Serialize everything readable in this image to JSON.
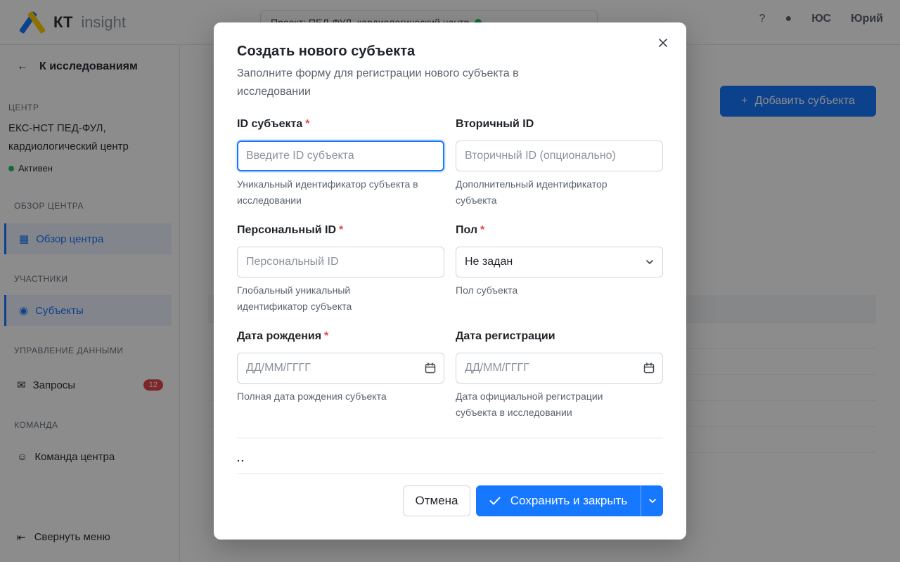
{
  "background": {
    "logo": {
      "mark": "kt-logo-icon",
      "kt": "КТ",
      "insight": "insight"
    },
    "project": {
      "label": "Проект: ПЕД-ФУЛ, кардиологический центр"
    },
    "user": {
      "initials": "ЮС",
      "name": "Юрий"
    },
    "sidebar": {
      "back": "К исследованиям",
      "center_label": "ЦЕНТР",
      "center_name": "ЕКС-НСТ ПЕД-ФУЛ, кардиологический центр",
      "center_status": "Активен",
      "group_center": "ОБЗОР ЦЕНТРА",
      "item_overview": "Обзор центра",
      "group_participants": "УЧАСТНИКИ",
      "item_subjects": "Субъекты",
      "group_data": "УПРАВЛЕНИЕ ДАННЫМИ",
      "item_queries": "Запросы",
      "queries_count": "12",
      "group_team": "КОМАНДА",
      "item_team": "Команда центра",
      "collapse": "Свернуть меню"
    },
    "main": {
      "add_button": "Добавить субъекта"
    }
  },
  "modal": {
    "title": "Создать нового субъекта",
    "subtitle": "Заполните форму для регистрации нового субъекта в исследовании",
    "fields": {
      "subject_id": {
        "label": "ID субъекта",
        "required": "*",
        "placeholder": "Введите ID субъекта",
        "value": "",
        "helper": "Уникальный идентификатор субъекта в исследовании"
      },
      "secondary_id": {
        "label": "Вторичный ID",
        "placeholder": "Вторичный ID (опционально)",
        "value": "",
        "helper": "Дополнительный идентификатор субъекта"
      },
      "personal_id": {
        "label": "Персональный ID",
        "required": "*",
        "placeholder": "Персональный ID",
        "value": "",
        "helper": "Глобальный уникальный идентификатор субъекта"
      },
      "sex": {
        "label": "Пол",
        "required": "*",
        "selected": "Не задан",
        "helper": "Пол субъекта"
      },
      "birth_date": {
        "label": "Дата рождения",
        "required": "*",
        "placeholder": "ДД/ММ/ГГГГ",
        "value": "",
        "helper": "Полная дата рождения субъекта"
      },
      "registration_date": {
        "label": "Дата регистрации",
        "placeholder": "ДД/ММ/ГГГГ",
        "value": "",
        "helper": "Дата официальной регистрации субъекта в исследовании"
      }
    },
    "section_marker": "..",
    "buttons": {
      "cancel": "Отмена",
      "save": "Сохранить и закрыть"
    }
  },
  "colors": {
    "accent": "#1677ff",
    "required": "#e5484d",
    "overlay": "rgba(0,0,0,0.45)"
  }
}
